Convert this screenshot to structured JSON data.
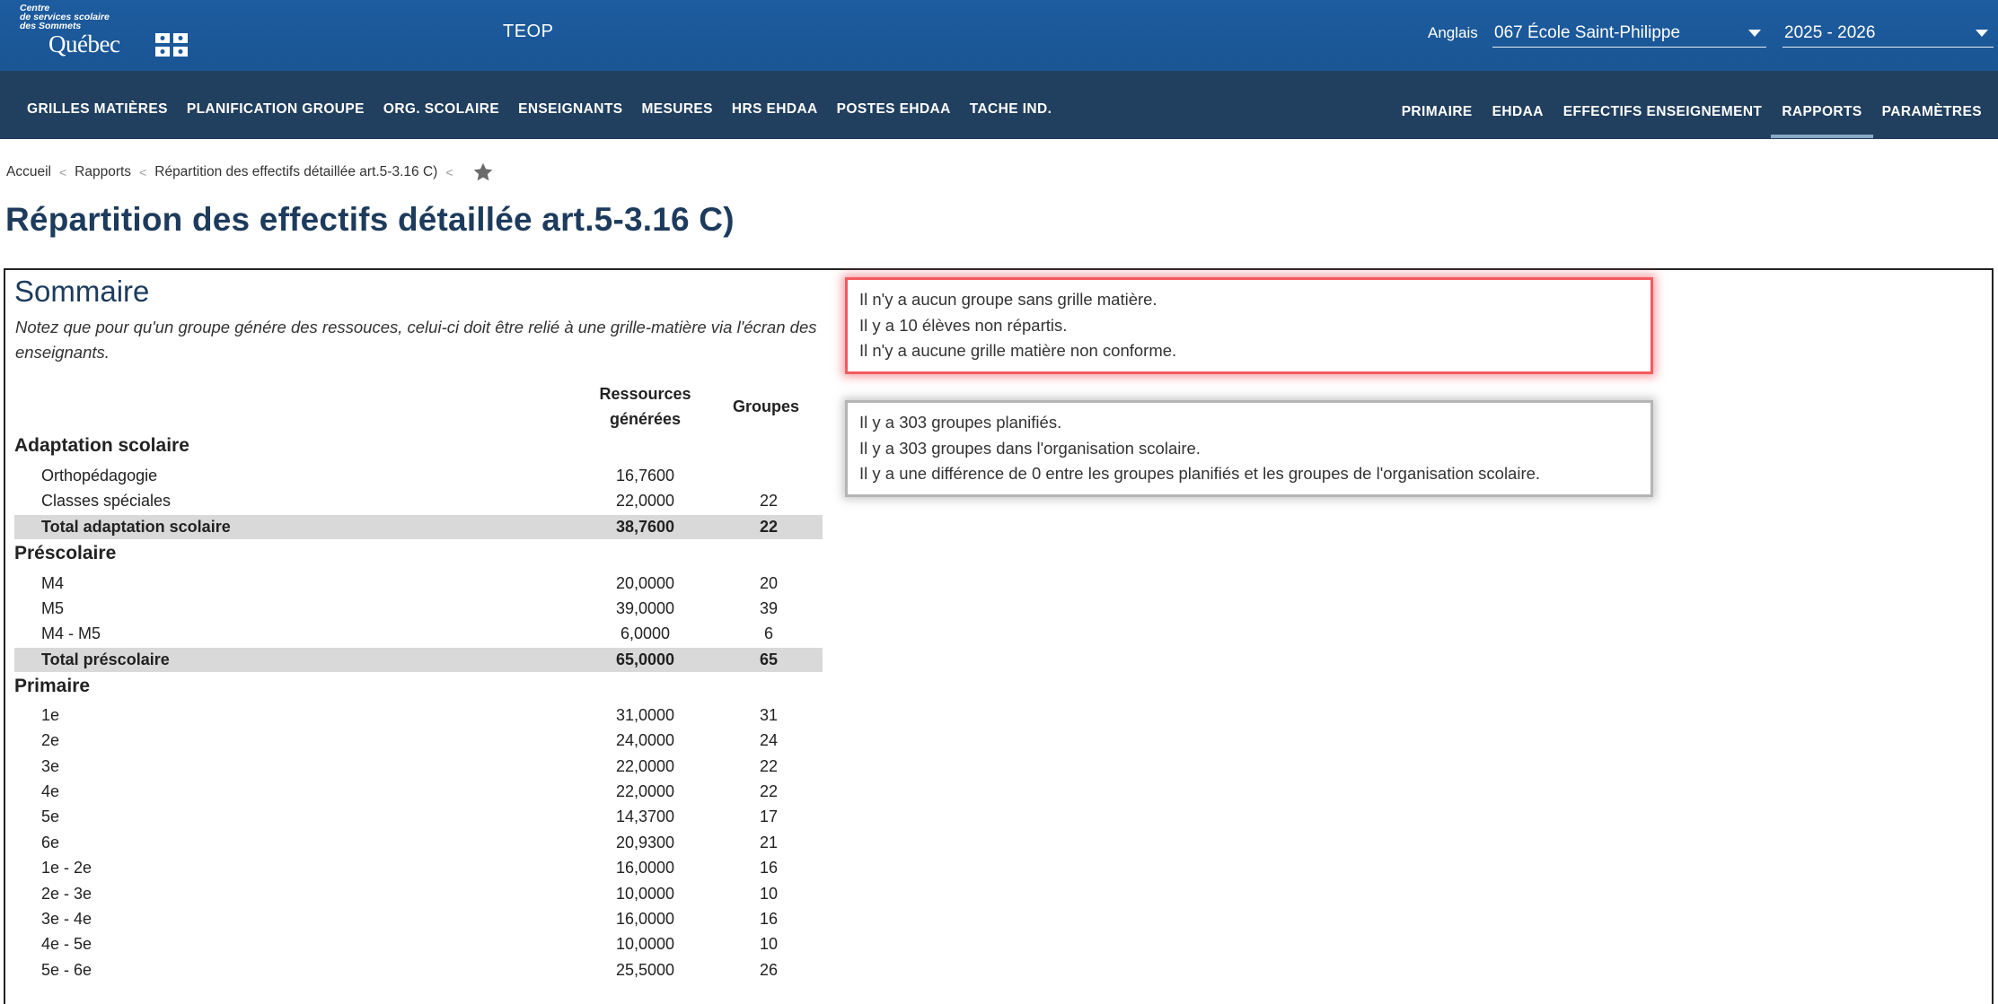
{
  "header": {
    "logo_small": [
      "Centre",
      "de services scolaire",
      "des Sommets"
    ],
    "logo_main": "Québec",
    "app_title": "TEOP",
    "language": "Anglais",
    "school": "067 École Saint-Philippe",
    "year": "2025 - 2026"
  },
  "nav_left": [
    "GRILLES MATIÈRES",
    "PLANIFICATION GROUPE",
    "ORG. SCOLAIRE",
    "ENSEIGNANTS",
    "MESURES",
    "HRS EHDAA",
    "POSTES EHDAA",
    "TACHE IND."
  ],
  "nav_right": [
    "PRIMAIRE",
    "EHDAA",
    "EFFECTIFS ENSEIGNEMENT",
    "RAPPORTS",
    "PARAMÈTRES"
  ],
  "nav_active": "RAPPORTS",
  "breadcrumb": [
    "Accueil",
    "Rapports",
    "Répartition des effectifs détaillée art.5-3.16 C)"
  ],
  "page_title": "Répartition des effectifs détaillée art.5-3.16 C)",
  "summary": {
    "title": "Sommaire",
    "note": "Notez que pour qu'un groupe génére des ressouces, celui-ci doit être relié à une grille-matière via l'écran des enseignants.",
    "col_resources": "Ressources générées",
    "col_groups": "Groupes",
    "sections": [
      {
        "name": "Adaptation scolaire",
        "rows": [
          {
            "label": "Orthopédagogie",
            "res": "16,7600",
            "grp": ""
          },
          {
            "label": "Classes spéciales",
            "res": "22,0000",
            "grp": "22"
          }
        ],
        "total": {
          "label": "Total adaptation scolaire",
          "res": "38,7600",
          "grp": "22"
        }
      },
      {
        "name": "Préscolaire",
        "rows": [
          {
            "label": "M4",
            "res": "20,0000",
            "grp": "20"
          },
          {
            "label": "M5",
            "res": "39,0000",
            "grp": "39"
          },
          {
            "label": "M4 - M5",
            "res": "6,0000",
            "grp": "6"
          }
        ],
        "total": {
          "label": "Total préscolaire",
          "res": "65,0000",
          "grp": "65"
        }
      },
      {
        "name": "Primaire",
        "rows": [
          {
            "label": "1e",
            "res": "31,0000",
            "grp": "31"
          },
          {
            "label": "2e",
            "res": "24,0000",
            "grp": "24"
          },
          {
            "label": "3e",
            "res": "22,0000",
            "grp": "22"
          },
          {
            "label": "4e",
            "res": "22,0000",
            "grp": "22"
          },
          {
            "label": "5e",
            "res": "14,3700",
            "grp": "17"
          },
          {
            "label": "6e",
            "res": "20,9300",
            "grp": "21"
          },
          {
            "label": "1e - 2e",
            "res": "16,0000",
            "grp": "16"
          },
          {
            "label": "2e - 3e",
            "res": "10,0000",
            "grp": "10"
          },
          {
            "label": "3e - 4e",
            "res": "16,0000",
            "grp": "16"
          },
          {
            "label": "4e - 5e",
            "res": "10,0000",
            "grp": "10"
          },
          {
            "label": "5e - 6e",
            "res": "25,5000",
            "grp": "26"
          }
        ]
      }
    ]
  },
  "alerts": {
    "red": [
      "Il n'y a aucun groupe sans grille matière.",
      "Il y a 10 élèves non répartis.",
      "Il n'y a aucune grille matière non conforme."
    ],
    "grey": [
      "Il y a 303 groupes planifiés.",
      "Il y a 303 groupes dans l'organisation scolaire.",
      "Il y a une différence de 0 entre les groupes planifiés et les groupes de l'organisation scolaire."
    ]
  },
  "colors": {
    "topbar": "#1c5a9b",
    "navbar": "#213f5e",
    "title": "#1d3b5c",
    "alert_red": "#f25b60"
  }
}
